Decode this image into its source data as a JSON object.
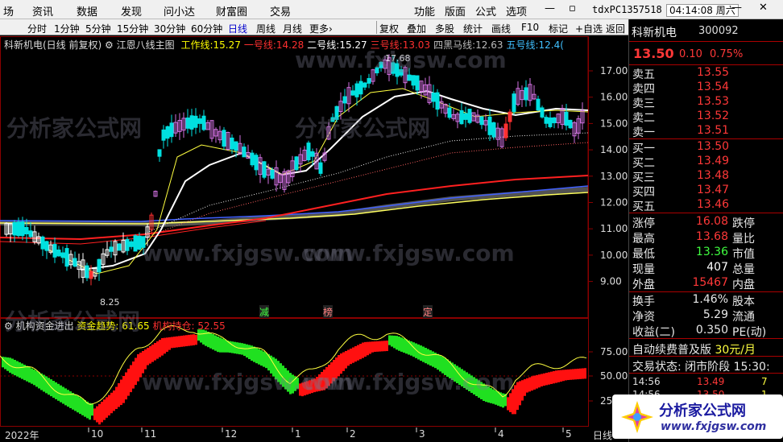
{
  "menubar": {
    "items": [
      "场",
      "资讯",
      "数据",
      "发现",
      "问小达",
      "财富圈",
      "交易"
    ],
    "right_items": [
      "功能",
      "版面",
      "公式",
      "选项"
    ],
    "account": "tdxPC1357518",
    "time": "04:14:08 周六"
  },
  "periodbar": {
    "periods": [
      "分时",
      "1分钟",
      "5分钟",
      "15分钟",
      "30分钟",
      "60分钟",
      "日线",
      "周线",
      "月线",
      "更多"
    ],
    "active": "日线",
    "more_suffix": "›",
    "tools": [
      "复权",
      "叠加",
      "多股",
      "统计",
      "画线",
      "F10",
      "标记",
      "+自选",
      "返回"
    ]
  },
  "main_chart": {
    "title": "科新机电(日线 前复权)",
    "indicator": "江恩八线主图",
    "lines": [
      {
        "label": "工作线:",
        "value": "15.27",
        "color": "#ffff00"
      },
      {
        "label": "一号线:",
        "value": "14.28",
        "color": "#ff3030"
      },
      {
        "label": "二号线:",
        "value": "15.27",
        "color": "#ffffff"
      },
      {
        "label": "三号线:",
        "value": "13.03",
        "color": "#ff3030"
      },
      {
        "label": "四黑马线:",
        "value": "12.63",
        "color": "#bbbbbb"
      },
      {
        "label": "五号线:",
        "value": "12.4(",
        "color": "#40c0ff"
      }
    ],
    "y_ticks": [
      "17.00",
      "16.00",
      "15.00",
      "14.00",
      "13.00",
      "12.00",
      "11.00",
      "10.00",
      "9.00"
    ],
    "high_label": "17.68",
    "low_label": "8.25",
    "signals": [
      {
        "text": "减",
        "color": "#40ff40"
      },
      {
        "text": "榜",
        "color": "#ff8080"
      },
      {
        "text": "定",
        "color": "#ff8080"
      }
    ]
  },
  "indicator_chart": {
    "title": "机构资金进出",
    "trend_label": "资金趋势:",
    "trend_value": "61.65",
    "pos_label": "机构持仓:",
    "pos_value": "52.55",
    "y_ticks": [
      "75.00",
      "50.00",
      "25.00"
    ]
  },
  "x_axis": {
    "labels": [
      "2022年",
      "10",
      "11",
      "12",
      "1",
      "2",
      "3",
      "4",
      "5"
    ],
    "suffix": "日线"
  },
  "quote": {
    "name": "科新机电",
    "code": "300092",
    "price": "13.50",
    "change": "0.10",
    "change_pct": "0.75%",
    "asks": [
      {
        "label": "卖五",
        "price": "13.55"
      },
      {
        "label": "卖四",
        "price": "13.54"
      },
      {
        "label": "卖三",
        "price": "13.53"
      },
      {
        "label": "卖二",
        "price": "13.52"
      },
      {
        "label": "卖一",
        "price": "13.51"
      }
    ],
    "bids": [
      {
        "label": "买一",
        "price": "13.50"
      },
      {
        "label": "买二",
        "price": "13.49"
      },
      {
        "label": "买三",
        "price": "13.48"
      },
      {
        "label": "买四",
        "price": "13.47"
      },
      {
        "label": "买五",
        "price": "13.46"
      }
    ],
    "stats": [
      {
        "l1": "涨停",
        "v1": "16.08",
        "c1": "#ff3838",
        "l2": "跌停"
      },
      {
        "l1": "最高",
        "v1": "13.68",
        "c1": "#ff3838",
        "l2": "量比"
      },
      {
        "l1": "最低",
        "v1": "13.36",
        "c1": "#40ff40",
        "l2": "市值"
      },
      {
        "l1": "现量",
        "v1": "407",
        "c1": "#ffffff",
        "l2": "总量"
      },
      {
        "l1": "外盘",
        "v1": "15467",
        "c1": "#ff3838",
        "l2": "内盘"
      }
    ],
    "stats2": [
      {
        "l1": "换手",
        "v1": "1.46%",
        "c1": "#e8e8e8",
        "l2": "股本"
      },
      {
        "l1": "净资",
        "v1": "5.29",
        "c1": "#e8e8e8",
        "l2": "流通"
      },
      {
        "l1": "收益(二)",
        "v1": "0.350",
        "c1": "#e8e8e8",
        "l2": "PE(动)"
      }
    ],
    "promo": "自动续费普及版",
    "promo_price": "30元/月",
    "trade_state": "交易状态: 闭市阶段 15:30:",
    "ticks": [
      {
        "time": "14:56",
        "price": "13.49",
        "vol": "7"
      },
      {
        "time": "14:56",
        "price": "13.50",
        "vol": "1"
      }
    ]
  },
  "watermark": {
    "text1": "分析家公式网",
    "text2": "www.fxjgsw.com",
    "logo_title": "分析家公式网",
    "logo_url": "www.fxjgsw.com"
  },
  "colors": {
    "up": "#ff3838",
    "down": "#00e0e0",
    "bg": "#000000",
    "grid": "#7a0000"
  }
}
